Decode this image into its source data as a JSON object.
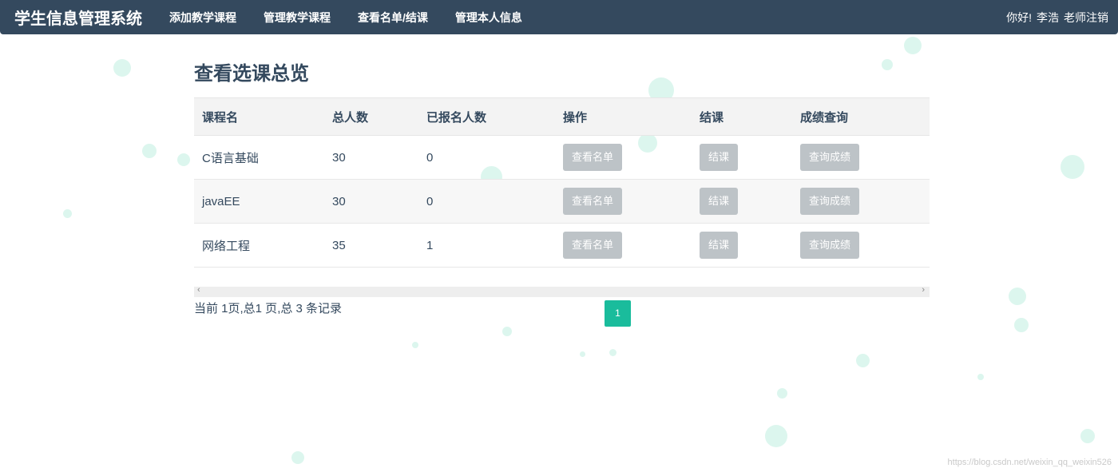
{
  "navbar": {
    "brand": "学生信息管理系统",
    "links": [
      "添加教学课程",
      "管理教学课程",
      "查看名单/结课",
      "管理本人信息"
    ],
    "greeting": "你好!",
    "user": "李浩",
    "logout": "老师注销"
  },
  "main": {
    "title": "查看选课总览",
    "table": {
      "headers": [
        "课程名",
        "总人数",
        "已报名人数",
        "操作",
        "结课",
        "成绩查询"
      ],
      "rows": [
        {
          "name": "C语言基础",
          "total": "30",
          "enrolled": "0",
          "view": "查看名单",
          "finish": "结课",
          "grades": "查询成绩"
        },
        {
          "name": "javaEE",
          "total": "30",
          "enrolled": "0",
          "view": "查看名单",
          "finish": "结课",
          "grades": "查询成绩"
        },
        {
          "name": "网络工程",
          "total": "35",
          "enrolled": "1",
          "view": "查看名单",
          "finish": "结课",
          "grades": "查询成绩"
        }
      ]
    },
    "scrollbar": {
      "left_icon": "‹",
      "right_icon": "›"
    },
    "pagination": {
      "info": "当前 1页,总1 页,总 3 条记录",
      "current_page": "1"
    }
  },
  "watermark": "https://blog.csdn.net/weixin_qq_weixin526",
  "colors": {
    "navbar": "#34495e",
    "accent": "#1abc9c",
    "button_disabled": "#bdc3c7"
  }
}
